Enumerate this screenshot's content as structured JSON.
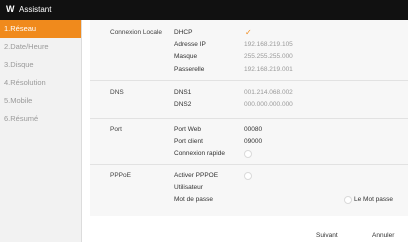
{
  "window": {
    "logo": "W",
    "title": "Assistant"
  },
  "sidebar": {
    "items": [
      {
        "label": "1.Réseau",
        "active": true
      },
      {
        "label": "2.Date/Heure"
      },
      {
        "label": "3.Disque"
      },
      {
        "label": "4.Résolution"
      },
      {
        "label": "5.Mobile"
      },
      {
        "label": "6.Résumé"
      }
    ]
  },
  "sections": {
    "local": {
      "title": "Connexion Locale",
      "dhcp_label": "DHCP",
      "dhcp_checked": true,
      "ip_label": "Adresse IP",
      "ip_value": "192.168.219.105",
      "mask_label": "Masque",
      "mask_value": "255.255.255.000",
      "gateway_label": "Passerelle",
      "gateway_value": "192.168.219.001"
    },
    "dns": {
      "title": "DNS",
      "dns1_label": "DNS1",
      "dns1_value": "001.214.068.002",
      "dns2_label": "DNS2",
      "dns2_value": "000.000.000.000"
    },
    "port": {
      "title": "Port",
      "web_label": "Port Web",
      "web_value": "00080",
      "client_label": "Port client",
      "client_value": "09000",
      "quick_label": "Connexion rapide"
    },
    "pppoe": {
      "title": "PPPoE",
      "enable_label": "Activer PPPOE",
      "user_label": "Utilisateur",
      "password_label": "Mot de passe",
      "show_password_label": "Le Mot passe"
    }
  },
  "footer": {
    "next_label": "Suivant",
    "cancel_label": "Annuler"
  },
  "colors": {
    "accent": "#f08a1c",
    "titlebar": "#111111",
    "sidebar": "#f2f2f2"
  }
}
